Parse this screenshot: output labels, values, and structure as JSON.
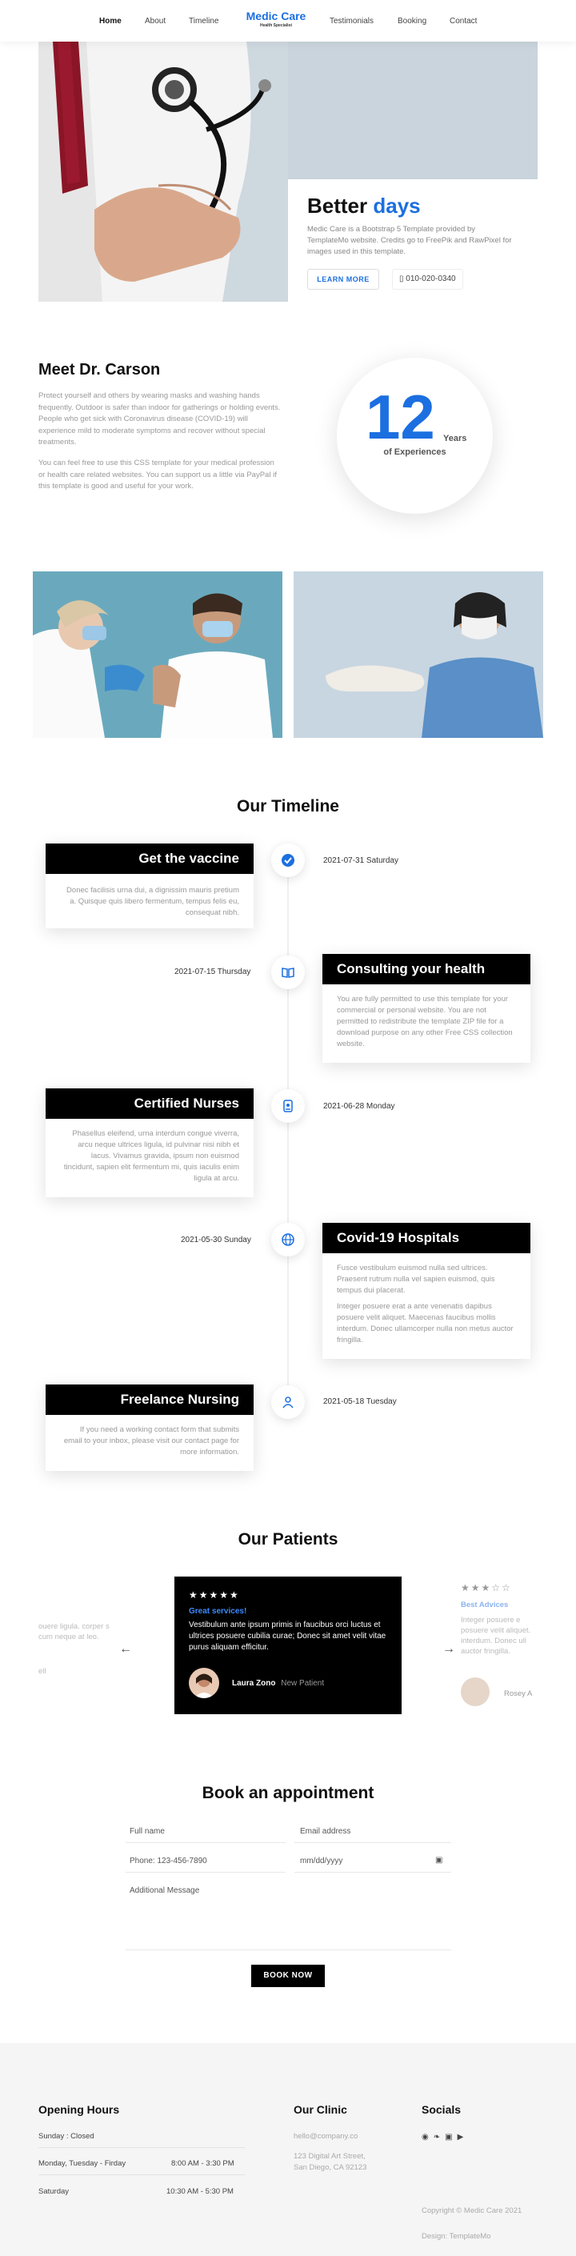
{
  "nav": {
    "links": [
      "Home",
      "About",
      "Timeline",
      "Testimonials",
      "Booking",
      "Contact"
    ],
    "brand": "Medic Care",
    "brand_sub": "Health Specialist"
  },
  "hero": {
    "title_part1": "Better ",
    "title_part2": "days",
    "text": "Medic Care is a Bootstrap 5 Template provided by TemplateMo website. Credits go to FreePik and RawPixel for images used in this template.",
    "button": "LEARN MORE",
    "phone": "010-020-0340"
  },
  "about": {
    "title": "Meet Dr. Carson",
    "p1": "Protect yourself and others by wearing masks and washing hands frequently. Outdoor is safer than indoor for gatherings or holding events. People who get sick with Coronavirus disease (COVID-19) will experience mild to moderate symptoms and recover without special treatments.",
    "p2": "You can feel free to use this CSS template for your medical profession or health care related websites. You can support us a little via PayPal if this template is good and useful for your work.",
    "years_num": "12",
    "years_label": "Years",
    "years_sub": "of Experiences"
  },
  "timeline": {
    "title": "Our Timeline",
    "items": [
      {
        "title": "Get the vaccine",
        "date": "2021-07-31 Saturday",
        "text": [
          "Donec facilisis urna dui, a dignissim mauris pretium a. Quisque quis libero fermentum, tempus felis eu, consequat nibh."
        ],
        "icon": "check-icon"
      },
      {
        "title": "Consulting your health",
        "date": "2021-07-15 Thursday",
        "text": [
          "You are fully permitted to use this template for your commercial or personal website. You are not permitted to redistribute the template ZIP file for a download purpose on any other Free CSS collection website."
        ],
        "icon": "book-icon"
      },
      {
        "title": "Certified Nurses",
        "date": "2021-06-28 Monday",
        "text": [
          "Phasellus eleifend, urna interdum congue viverra, arcu neque ultrices ligula, id pulvinar nisi nibh et lacus. Vivamus gravida, ipsum non euismod tincidunt, sapien elit fermentum mi, quis iaculis enim ligula at arcu."
        ],
        "icon": "badge-icon"
      },
      {
        "title": "Covid-19 Hospitals",
        "date": "2021-05-30 Sunday",
        "text": [
          "Fusce vestibulum euismod nulla sed ultrices. Praesent rutrum nulla vel sapien euismod, quis tempus dui placerat.",
          "Integer posuere erat a ante venenatis dapibus posuere velit aliquet. Maecenas faucibus mollis interdum. Donec ullamcorper nulla non metus auctor fringilla."
        ],
        "icon": "globe-icon"
      },
      {
        "title": "Freelance Nursing",
        "date": "2021-05-18 Tuesday",
        "text": [
          "If you need a working contact form that submits email to your inbox, please visit our contact page for more information."
        ],
        "icon": "person-icon"
      }
    ]
  },
  "patients": {
    "title": "Our Patients",
    "main": {
      "stars": "★★★★★",
      "label": "Great services!",
      "text": "Vestibulum ante ipsum primis in faucibus orci luctus et ultrices posuere cubilia curae; Donec sit amet velit vitae purus aliquam efficitur.",
      "name": "Laura Zono",
      "role": "New Patient"
    },
    "left_card": {
      "text": "ouere ligula. corper s cum neque at leo.",
      "name": "ell"
    },
    "right_card": {
      "stars": "★★★☆☆",
      "label": "Best Advices",
      "text": "Integer posuere e posuere velit aliquet. interdum. Donec ull auctor fringilla.",
      "name": "Rosey A"
    }
  },
  "booking": {
    "title": "Book an appointment",
    "name_placeholder": "Full name",
    "email_placeholder": "Email address",
    "phone_placeholder": "Phone: 123-456-7890",
    "date_placeholder": "mm/dd/yyyy",
    "message_placeholder": "Additional Message",
    "button": "BOOK NOW"
  },
  "footer": {
    "hours_title": "Opening Hours",
    "hours": [
      {
        "day": "Sunday : Closed",
        "time": ""
      },
      {
        "day": "Monday, Tuesday - Firday",
        "time": "8:00 AM - 3:30 PM"
      },
      {
        "day": "Saturday",
        "time": "10:30 AM - 5:30 PM"
      }
    ],
    "clinic_title": "Our Clinic",
    "email": "hello@company.co",
    "address": "123 Digital Art Street, San Diego, CA 92123",
    "socials_title": "Socials",
    "copyright": "Copyright © Medic Care 2021",
    "design": "Design: TemplateMo"
  }
}
